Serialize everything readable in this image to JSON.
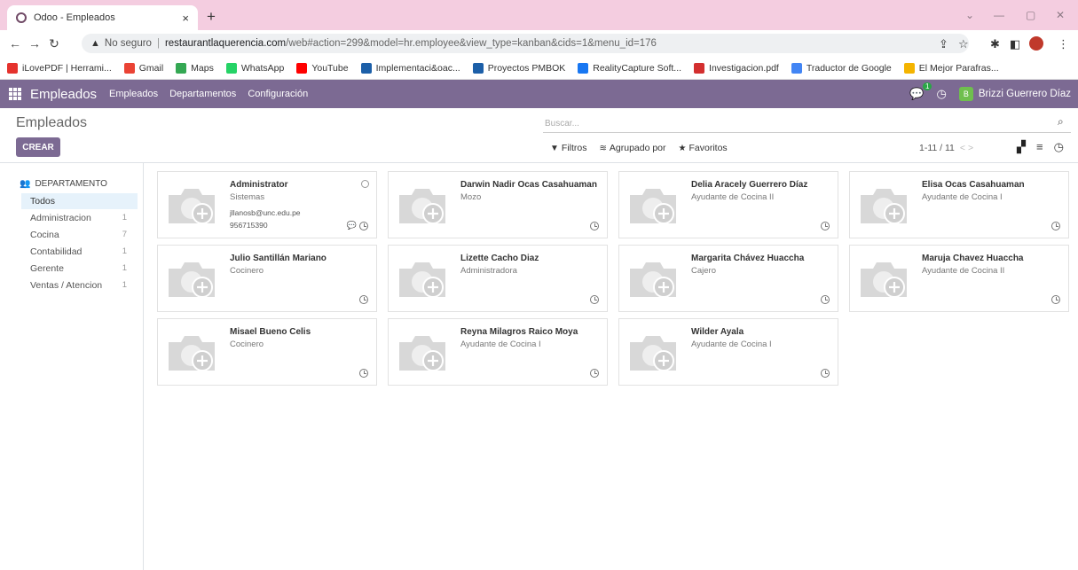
{
  "browser": {
    "tab_title": "Odoo - Empleados",
    "tab_close": "×",
    "new_tab": "+",
    "address": {
      "warning": "▲",
      "insecure_label": "No seguro",
      "separator": "|",
      "host": "restaurantlaquerencia.com",
      "path": "/web#action=299&model=hr.employee&view_type=kanban&cids=1&menu_id=176"
    },
    "bookmarks": [
      {
        "label": "iLovePDF | Herrami...",
        "color": "#e5322d"
      },
      {
        "label": "Gmail",
        "color": "#ea4335"
      },
      {
        "label": "Maps",
        "color": "#34a853"
      },
      {
        "label": "WhatsApp",
        "color": "#25d366"
      },
      {
        "label": "YouTube",
        "color": "#ff0000"
      },
      {
        "label": "Implementaci&oac...",
        "color": "#1c5fa8"
      },
      {
        "label": "Proyectos PMBOK",
        "color": "#1c5fa8"
      },
      {
        "label": "RealityCapture Soft...",
        "color": "#1877f2"
      },
      {
        "label": "Investigacion.pdf",
        "color": "#d32f2f"
      },
      {
        "label": "Traductor de Google",
        "color": "#4285f4"
      },
      {
        "label": "El Mejor Parafras...",
        "color": "#f4b400"
      }
    ]
  },
  "navbar": {
    "app_name": "Empleados",
    "menus": [
      "Empleados",
      "Departamentos",
      "Configuración"
    ],
    "chat_badge": "1",
    "avatar_letter": "B",
    "user_name": "Brizzi Guerrero Díaz",
    "color": "#7c6a93"
  },
  "control": {
    "title": "Empleados",
    "create_label": "CREAR",
    "search_placeholder": "Buscar...",
    "filters_label": "Filtros",
    "groupby_label": "Agrupado por",
    "favorites_label": "Favoritos",
    "pager": "1-11 / 11"
  },
  "sidebar": {
    "heading": "DEPARTAMENTO",
    "items": [
      {
        "label": "Todos",
        "count": ""
      },
      {
        "label": "Administracion",
        "count": "1"
      },
      {
        "label": "Cocina",
        "count": "7"
      },
      {
        "label": "Contabilidad",
        "count": "1"
      },
      {
        "label": "Gerente",
        "count": "1"
      },
      {
        "label": "Ventas / Atencion",
        "count": "1"
      }
    ]
  },
  "employees": [
    {
      "name": "Administrator",
      "job": "Sistemas",
      "email": "jllanosb@unc.edu.pe",
      "phone": "956715390"
    },
    {
      "name": "Darwin Nadir Ocas Casahuaman",
      "job": "Mozo"
    },
    {
      "name": "Delia Aracely Guerrero Díaz",
      "job": "Ayudante de Cocina II"
    },
    {
      "name": "Elisa Ocas Casahuaman",
      "job": "Ayudante de Cocina I"
    },
    {
      "name": "Julio Santillán Mariano",
      "job": "Cocinero"
    },
    {
      "name": "Lizette Cacho Diaz",
      "job": "Administradora"
    },
    {
      "name": "Margarita Chávez Huaccha",
      "job": "Cajero"
    },
    {
      "name": "Maruja Chavez Huaccha",
      "job": "Ayudante de Cocina II"
    },
    {
      "name": "Misael Bueno Celis",
      "job": "Cocinero"
    },
    {
      "name": "Reyna Milagros Raico Moya",
      "job": "Ayudante de Cocina I"
    },
    {
      "name": "Wilder Ayala",
      "job": "Ayudante de Cocina I"
    }
  ]
}
